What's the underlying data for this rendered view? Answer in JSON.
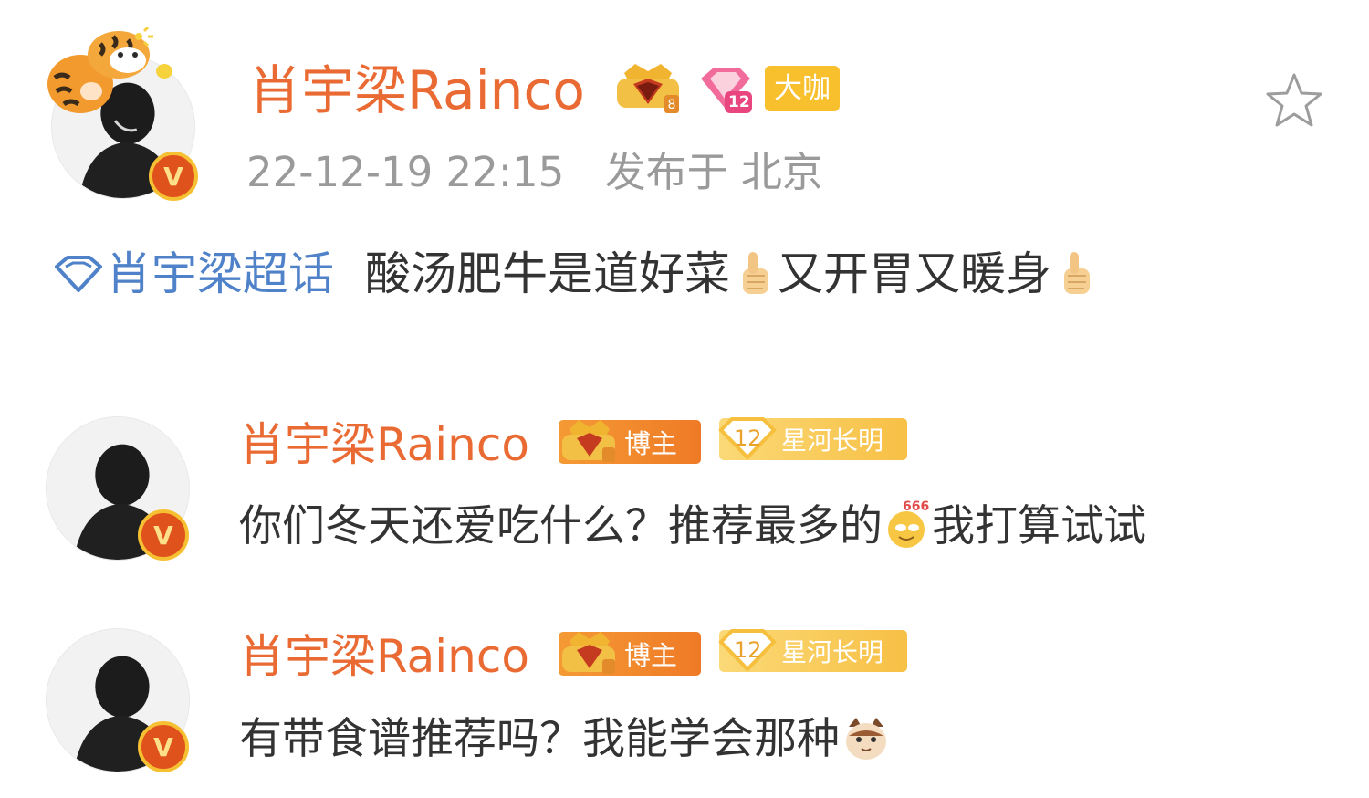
{
  "post": {
    "author": "肖宇梁Rainco",
    "badge_label": "大咖",
    "level_number": "12",
    "datetime": "22-12-19 22:15",
    "location": "发布于 北京",
    "topic": "肖宇梁超话",
    "text_part1": "酸汤肥牛是道好菜",
    "text_part2": "又开胃又暖身",
    "verified_mark": "V",
    "star_icon": "star-outline-icon"
  },
  "comments": [
    {
      "author": "肖宇梁Rainco",
      "role_badge": "博主",
      "level_number": "12",
      "level_title": "星河长明",
      "text_part1": "你们冬天还爱吃什么？推荐最多的",
      "text_part2": "我打算试试",
      "emoji_label": "666",
      "verified_mark": "V"
    },
    {
      "author": "肖宇梁Rainco",
      "role_badge": "博主",
      "level_number": "12",
      "level_title": "星河长明",
      "text_part1": "有带食谱推荐吗？我能学会那种",
      "verified_mark": "V"
    }
  ],
  "colors": {
    "name_orange": "#ea6a33",
    "topic_blue": "#4f82c8",
    "meta_gray": "#9a9a9a",
    "verified_red": "#e0521b",
    "gold": "#f9c02e"
  }
}
